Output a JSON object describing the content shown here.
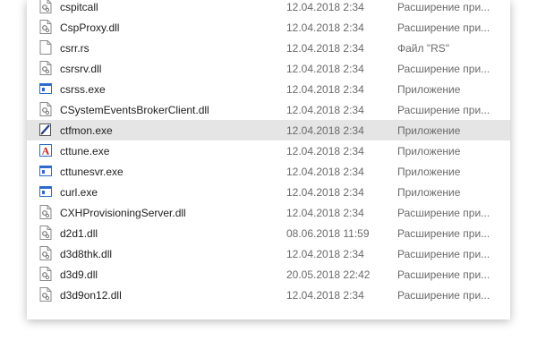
{
  "files": [
    {
      "name": "cspitcall",
      "date": "12.04.2018 2:34",
      "type": "Расширение при...",
      "icon": "dll-icon"
    },
    {
      "name": "CspProxy.dll",
      "date": "12.04.2018 2:34",
      "type": "Расширение при...",
      "icon": "dll-icon"
    },
    {
      "name": "csrr.rs",
      "date": "12.04.2018 2:34",
      "type": "Файл \"RS\"",
      "icon": "file-icon"
    },
    {
      "name": "csrsrv.dll",
      "date": "12.04.2018 2:34",
      "type": "Расширение при...",
      "icon": "dll-icon"
    },
    {
      "name": "csrss.exe",
      "date": "12.04.2018 2:34",
      "type": "Приложение",
      "icon": "exe-icon"
    },
    {
      "name": "CSystemEventsBrokerClient.dll",
      "date": "12.04.2018 2:34",
      "type": "Расширение при...",
      "icon": "dll-icon"
    },
    {
      "name": "ctfmon.exe",
      "date": "12.04.2018 2:34",
      "type": "Приложение",
      "icon": "ctfmon-icon",
      "selected": true
    },
    {
      "name": "cttune.exe",
      "date": "12.04.2018 2:34",
      "type": "Приложение",
      "icon": "cttune-icon"
    },
    {
      "name": "cttunesvr.exe",
      "date": "12.04.2018 2:34",
      "type": "Приложение",
      "icon": "exe-icon"
    },
    {
      "name": "curl.exe",
      "date": "12.04.2018 2:34",
      "type": "Приложение",
      "icon": "exe-icon"
    },
    {
      "name": "CXHProvisioningServer.dll",
      "date": "12.04.2018 2:34",
      "type": "Расширение при...",
      "icon": "dll-icon"
    },
    {
      "name": "d2d1.dll",
      "date": "08.06.2018 11:59",
      "type": "Расширение при...",
      "icon": "dll-icon"
    },
    {
      "name": "d3d8thk.dll",
      "date": "12.04.2018 2:34",
      "type": "Расширение при...",
      "icon": "dll-icon"
    },
    {
      "name": "d3d9.dll",
      "date": "20.05.2018 22:42",
      "type": "Расширение при...",
      "icon": "dll-icon"
    },
    {
      "name": "d3d9on12.dll",
      "date": "12.04.2018 2:34",
      "type": "Расширение при...",
      "icon": "dll-icon"
    }
  ],
  "colors": {
    "selection": "#e5e5e5",
    "text": "#1e1e1e",
    "muted": "#6a6a6a"
  }
}
